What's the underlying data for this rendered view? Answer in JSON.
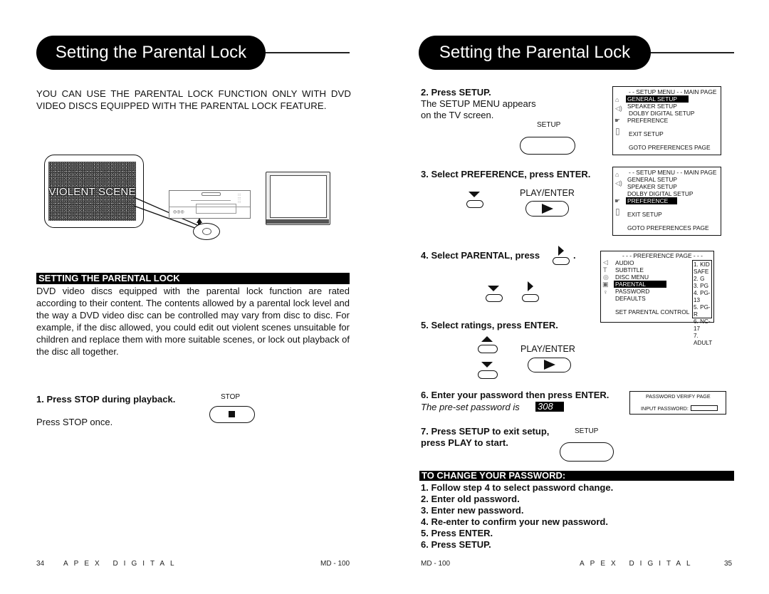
{
  "left_page": {
    "title": "Setting the Parental Lock",
    "intro_line1": "YOU CAN USE THE PARENTAL LOCK FUNCTION ONLY WITH DVD",
    "intro_line2": "VIDEO DISCS EQUIPPED WITH THE PARENTAL LOCK FEATURE.",
    "illustration": {
      "screen_caption": "VIOLENT SCENE"
    },
    "section_heading": "SETTING THE PARENTAL LOCK",
    "section_body": "DVD video discs equipped with the parental lock function are rated according to their content. The contents allowed by a parental lock level and the way a DVD video disc can be controlled may vary from disc to disc. For example, if the disc allowed, you could edit out violent scenes unsuitable for children and replace them with more suitable scenes, or lock out playback of the disc all together.",
    "step1": {
      "heading": "1. Press STOP during playback.",
      "body": "Press STOP once.",
      "button_label": "STOP",
      "button_icon": "stop-square-icon"
    },
    "footer": {
      "page_number": "34",
      "brand": "APEX DIGITAL",
      "model": "MD - 100"
    }
  },
  "right_page": {
    "title": "Setting the Parental Lock",
    "step2": {
      "heading": "2. Press SETUP.",
      "body_line1": "The SETUP MENU appears",
      "body_line2": "on the TV screen.",
      "button_label": "SETUP"
    },
    "setup_menu_1": {
      "header": "- - SETUP MENU  - -  MAIN PAGE",
      "items": [
        "GENERAL SETUP",
        "SPEAKER SETUP",
        "DOLBY DIGITAL SETUP",
        "PREFERENCE"
      ],
      "highlighted": "GENERAL SETUP",
      "exit": "EXIT SETUP",
      "goto": "GOTO PREFERENCES PAGE"
    },
    "step3": {
      "heading": "3. Select PREFERENCE, press ENTER.",
      "button_label": "PLAY/ENTER"
    },
    "setup_menu_2": {
      "header": "- - SETUP MENU  - -  MAIN PAGE",
      "items": [
        "GENERAL SETUP",
        "SPEAKER SETUP",
        "DOLBY DIGITAL SETUP",
        "PREFERENCE"
      ],
      "highlighted": "PREFERENCE",
      "exit": "EXIT SETUP",
      "goto": "GOTO PREFERENCES PAGE"
    },
    "step4": {
      "heading": "4. Select PARENTAL, press",
      "period": "."
    },
    "preference_page": {
      "header": "- - - PREFERENCE PAGE - - -",
      "items": [
        "AUDIO",
        "SUBTITLE",
        "DISC MENU",
        "PARENTAL",
        "PASSWORD",
        "DEFAULTS"
      ],
      "highlighted": "PARENTAL",
      "footer": "SET PARENTAL CONTROL",
      "ratings": [
        "1. KID SAFE",
        "2. G",
        "3. PG",
        "4. PG-13",
        "5. PG-R",
        "6. NC-17",
        "7. ADULT"
      ]
    },
    "step5": {
      "heading": "5. Select ratings, press ENTER.",
      "button_label": "PLAY/ENTER"
    },
    "step6": {
      "heading": "6. Enter your password then press ENTER.",
      "preset_text": "The pre-set password is",
      "preset_value": "308"
    },
    "password_page": {
      "header": "PASSWORD VERIFY PAGE",
      "input_label": "INPUT PASSWORD:"
    },
    "step7": {
      "heading_line1": "7. Press SETUP to exit setup,",
      "heading_line2": "press PLAY to start.",
      "button_label": "SETUP"
    },
    "change_password": {
      "heading": "TO CHANGE YOUR PASSWORD:",
      "steps": [
        "1. Follow step 4 to select password change.",
        "2. Enter old password.",
        "3. Enter new password.",
        "4. Re-enter to confirm your new password.",
        "5. Press ENTER.",
        "6. Press SETUP."
      ]
    },
    "footer": {
      "page_number": "35",
      "brand": "APEX DIGITAL",
      "model": "MD - 100"
    }
  }
}
